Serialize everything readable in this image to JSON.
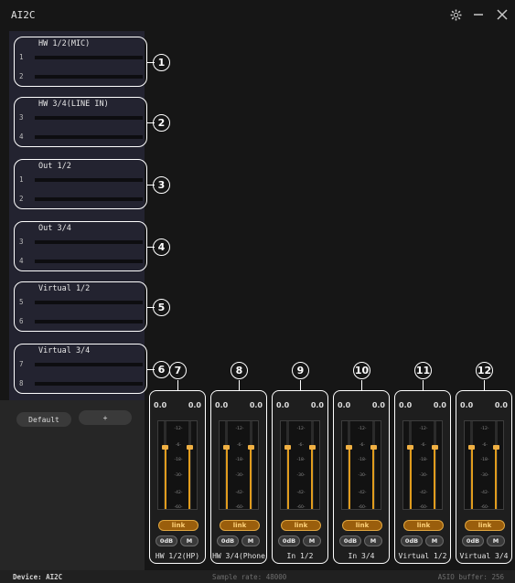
{
  "app": {
    "title": "AI2C"
  },
  "window_controls": {
    "settings": "⚙",
    "minimize": "—",
    "close": "✕"
  },
  "input_groups": [
    {
      "name": "HW 1/2(MIC)",
      "channels": [
        "1",
        "2"
      ],
      "callout": "1"
    },
    {
      "name": "HW 3/4(LINE IN)",
      "channels": [
        "3",
        "4"
      ],
      "callout": "2"
    },
    {
      "name": "Out 1/2",
      "channels": [
        "1",
        "2"
      ],
      "callout": "3"
    },
    {
      "name": "Out 3/4",
      "channels": [
        "3",
        "4"
      ],
      "callout": "4"
    },
    {
      "name": "Virtual 1/2",
      "channels": [
        "5",
        "6"
      ],
      "callout": "5"
    },
    {
      "name": "Virtual 3/4",
      "channels": [
        "7",
        "8"
      ],
      "callout": "6"
    }
  ],
  "presets": {
    "default_label": "Default",
    "add_label": "+"
  },
  "mixer": {
    "scale_ticks": [
      "-12-",
      "-6-",
      "-18-",
      "-30-",
      "-42-",
      "-60-"
    ],
    "link_label": "link",
    "zero_db_label": "0dB",
    "mute_label": "M",
    "strips": [
      {
        "name": "HW 1/2(HP)",
        "left": "0.0",
        "right": "0.0",
        "callout": "7"
      },
      {
        "name": "HW 3/4(Phone",
        "left": "0.0",
        "right": "0.0",
        "callout": "8"
      },
      {
        "name": "In 1/2",
        "left": "0.0",
        "right": "0.0",
        "callout": "9"
      },
      {
        "name": "In 3/4",
        "left": "0.0",
        "right": "0.0",
        "callout": "10"
      },
      {
        "name": "Virtual 1/2",
        "left": "0.0",
        "right": "0.0",
        "callout": "11"
      },
      {
        "name": "Virtual 3/4",
        "left": "0.0",
        "right": "0.0",
        "callout": "12"
      }
    ]
  },
  "status": {
    "device": "Device: AI2C",
    "sample_rate": "Sample rate: 48000",
    "buffer": "ASIO buffer: 256"
  },
  "colors": {
    "accent": "#e19c1d",
    "background": "#161616",
    "panel": "#232330"
  }
}
